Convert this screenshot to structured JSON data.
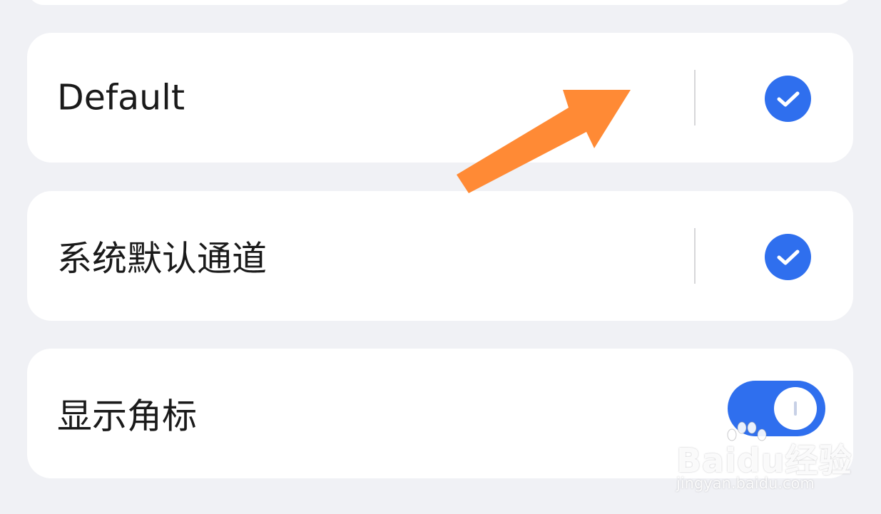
{
  "settings": {
    "rows": [
      {
        "label": "Default",
        "control": "checkmark",
        "checked": true
      },
      {
        "label": "系统默认通道",
        "control": "checkmark",
        "checked": true
      },
      {
        "label": "显示角标",
        "control": "toggle",
        "on": true
      }
    ]
  },
  "colors": {
    "background": "#f0f1f5",
    "card": "#ffffff",
    "accent": "#2f6fee",
    "arrow": "#ff8a35"
  },
  "icons": {
    "check": "check-circle-icon",
    "arrow": "orange-pointer-arrow-icon"
  },
  "watermark": {
    "brand": "Baidu经验",
    "url": "jingyan.baidu.com"
  }
}
